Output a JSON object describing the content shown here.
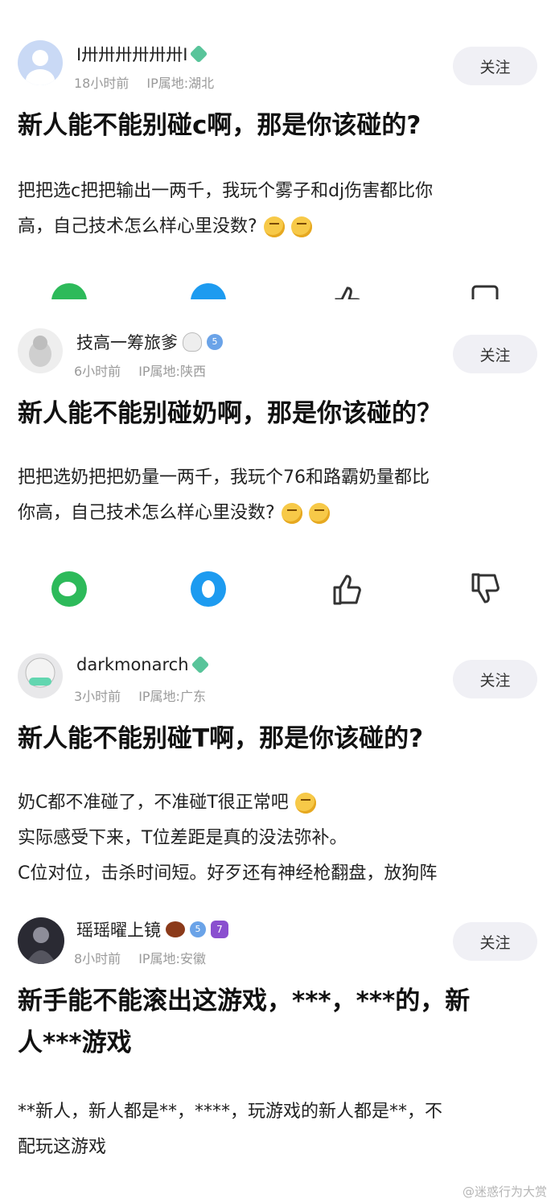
{
  "posts": [
    {
      "username": "I卅卅卅卅卅卅I",
      "time": "18小时前",
      "ip": "IP属地:湖北",
      "follow_label": "关注",
      "title": "新人能不能别碰c啊，那是你该碰的?",
      "body_lines": [
        "把把选c把把输出一两千，我玩个雾子和dj伤害都比你",
        "高，自己技术怎么样心里没数?"
      ]
    },
    {
      "username": "技高一筹旅爹",
      "time": "6小时前",
      "ip": "IP属地:陕西",
      "follow_label": "关注",
      "title": "新人能不能别碰奶啊，那是你该碰的？",
      "body_lines": [
        "把把选奶把把奶量一两千，我玩个76和路霸奶量都比",
        "你高，自己技术怎么样心里没数?"
      ],
      "level": "5"
    },
    {
      "username": "darkmonarch",
      "time": "3小时前",
      "ip": "IP属地:广东",
      "follow_label": "关注",
      "title": "新人能不能别碰T啊，那是你该碰的?",
      "body_lines": [
        "奶C都不准碰了，不准碰T很正常吧",
        "实际感受下来，T位差距是真的没法弥补。",
        "C位对位，击杀时间短。好歹还有神经枪翻盘，放狗阵"
      ]
    },
    {
      "username": "瑶瑶曜上镜",
      "time": "8小时前",
      "ip": "IP属地:安徽",
      "follow_label": "关注",
      "title_lines": [
        "新手能不能滚出这游戏，***，***的，新",
        "人***游戏"
      ],
      "body_lines": [
        "**新人，新人都是**，****，玩游戏的新人都是**，不",
        "配玩这游戏"
      ],
      "level": "5",
      "level2": "7"
    }
  ],
  "watermark": "@迷惑行为大赏"
}
